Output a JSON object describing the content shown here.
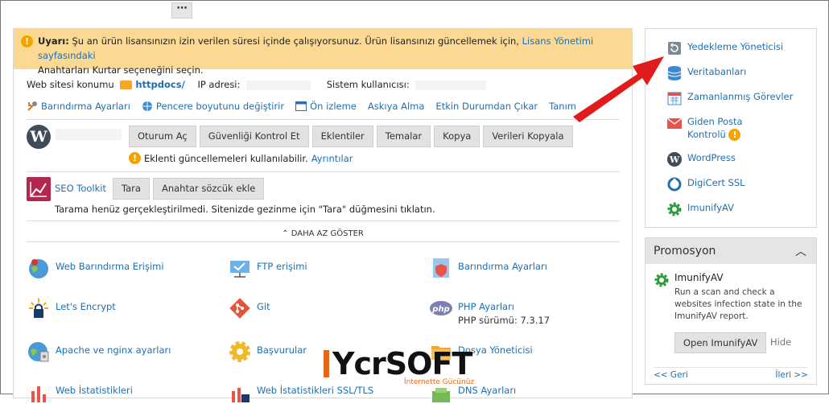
{
  "toolbar": {
    "more": "⋯"
  },
  "warning": {
    "bold": "Uyarı:",
    "text": " Şu an ürün lisansınızın izin verilen süresi içinde çalışıyorsunuz. Ürün lisansınızı güncellemek için, ",
    "link": "Lisans Yönetimi sayfasındaki",
    "line2": "Anahtarları Kurtar seçeneğini seçin."
  },
  "site_info": {
    "konum_label": "Web sitesi konumu",
    "konum_value": "httpdocs/",
    "ip_label": "IP adresi:",
    "user_label": "Sistem kullanıcısı:"
  },
  "actions": [
    "Barındırma Ayarları",
    "Pencere boyutunu değiştirir",
    "Ön izleme",
    "Askıya Alma",
    "Etkin Durumdan Çıkar",
    "Tanım"
  ],
  "wordpress": {
    "buttons": [
      "Oturum Aç",
      "Güvenliği Kontrol Et",
      "Eklentiler",
      "Temalar",
      "Kopya",
      "Verileri Kopyala"
    ],
    "note": "Eklenti güncellemeleri kullanılabilir.",
    "note_link": "Ayrıntılar"
  },
  "seo": {
    "title": "SEO Toolkit",
    "buttons": [
      "Tara",
      "Anahtar sözcük ekle"
    ],
    "note": "Tarama henüz gerçekleştirilmedi. Sitenizde gezinme için \"Tara\" düğmesini tıklatın."
  },
  "daha": "DAHA AZ GÖSTER",
  "tiles": [
    {
      "label": "Web Barındırma Erişimi",
      "icon": "globe-user-icon"
    },
    {
      "label": "FTP erişimi",
      "icon": "ftp-folder-icon"
    },
    {
      "label": "Barındırma Ayarları",
      "icon": "hosting-settings-icon"
    },
    {
      "label": "Let's Encrypt",
      "icon": "lets-encrypt-icon"
    },
    {
      "label": "Git",
      "icon": "git-icon"
    },
    {
      "label": "PHP Ayarları",
      "icon": "php-icon",
      "sub": "PHP sürümü: 7.3.17"
    },
    {
      "label": "Apache ve nginx ayarları",
      "icon": "apache-nginx-icon"
    },
    {
      "label": "Başvurular",
      "icon": "applications-gear-icon"
    },
    {
      "label": "Dosya Yöneticisi",
      "icon": "file-manager-icon"
    },
    {
      "label": "Web İstatistikleri",
      "icon": "web-stats-icon"
    },
    {
      "label": "Web İstatistikleri SSL/TLS",
      "icon": "web-stats-ssl-icon"
    },
    {
      "label": "DNS Ayarları",
      "icon": "dns-icon"
    }
  ],
  "sidebar": [
    {
      "label": "Yedekleme Yöneticisi",
      "icon": "backup-icon"
    },
    {
      "label": "Veritabanları",
      "icon": "database-icon"
    },
    {
      "label": "Zamanlanmış Görevler",
      "icon": "calendar-icon"
    },
    {
      "label": "Giden Posta",
      "label2": "Kontrolü",
      "icon": "mail-icon"
    },
    {
      "label": "WordPress",
      "icon": "wordpress-icon"
    },
    {
      "label": "DigiCert SSL",
      "icon": "digicert-icon"
    },
    {
      "label": "ImunifyAV",
      "icon": "imunify-icon"
    }
  ],
  "promo": {
    "title": "Promosyon",
    "product": "ImunifyAV",
    "desc": "Run a scan and check a websites infection state in the ImunifyAV report.",
    "open": "Open ImunifyAV",
    "hide": "Hide",
    "prev": "<< Geri",
    "next": "İleri >>"
  },
  "watermark": {
    "text": "YcrSOFT",
    "sub": "İnternette Gücünüz"
  },
  "colors": {
    "link": "#1f6fb2",
    "warning_bg": "#fbd993",
    "arrow": "#e01b1b",
    "accent": "#e6671a"
  }
}
